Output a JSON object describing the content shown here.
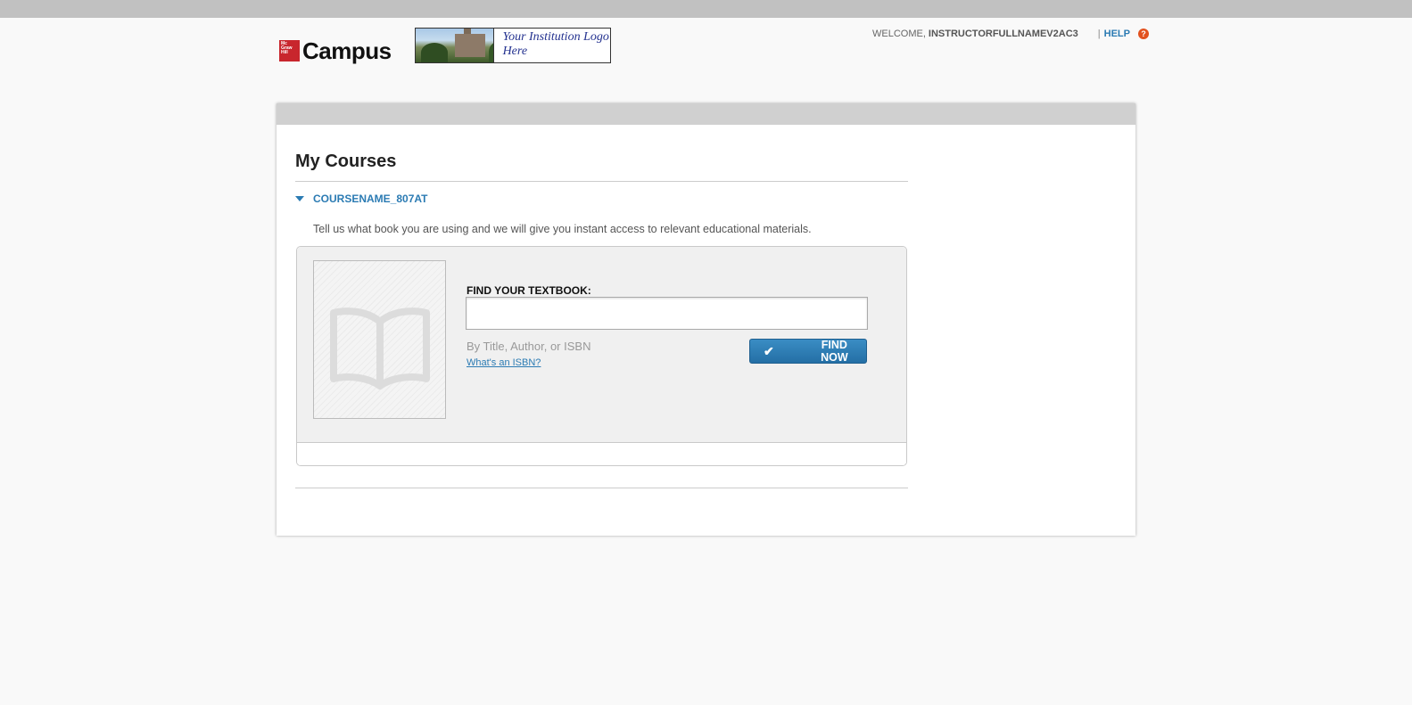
{
  "header": {
    "logo_brand_text": "Campus",
    "logo_mh_text": "Mc Graw Hill Education",
    "institution_logo_text": "Your Institution Logo Here",
    "welcome_label": "WELCOME,",
    "user_name": "INSTRUCTORFULLNAMEV2AC3",
    "separator": "|",
    "help_label": "HELP",
    "help_icon_glyph": "?"
  },
  "main": {
    "page_title": "My Courses",
    "course": {
      "name": "COURSENAME_807AT",
      "instruction": "Tell us what book you are using and we will give you instant access to relevant educational materials.",
      "find": {
        "label": "FIND YOUR TEXTBOOK:",
        "input_value": "",
        "input_placeholder": "",
        "hint": "By Title, Author, or ISBN",
        "isbn_link": "What's an ISBN?",
        "button_label": "FIND NOW",
        "button_icon": "checkmark-icon"
      }
    }
  },
  "colors": {
    "accent_blue": "#2b7bb3",
    "help_orange": "#e2521f",
    "top_bar": "#c1c1c1",
    "page_bg": "#f9f9f9"
  }
}
